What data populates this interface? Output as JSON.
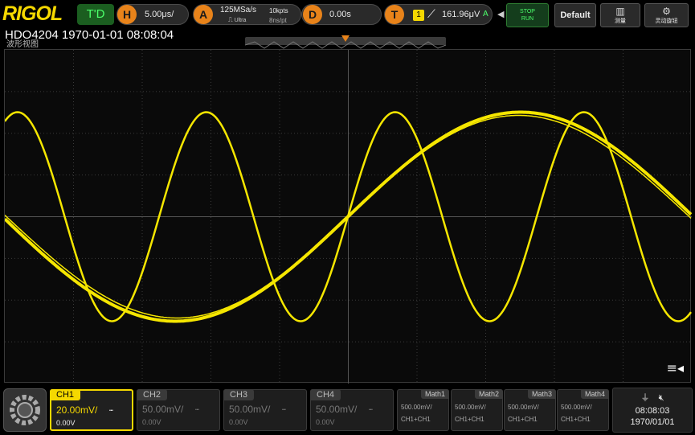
{
  "brand": "RIGOL",
  "device": "HDO4204 1970-01-01 08:08:04",
  "view_label": "波形视图",
  "trigger_status": "T'D",
  "horizontal": {
    "badge": "H",
    "timebase": "5.00μs/"
  },
  "acquisition": {
    "badge": "A",
    "sample_rate": "125MSa/s",
    "mode": "Ultra",
    "memory_depth": "10kpts",
    "resolution": "8ns/pt"
  },
  "delay": {
    "badge": "D",
    "value": "0.00s"
  },
  "trigger": {
    "badge": "T",
    "source": "1",
    "level": "161.96μV",
    "sweep": "A"
  },
  "buttons": {
    "stop": "STOP",
    "run": "RUN",
    "default": "Default",
    "measure": "测量",
    "autoset": "灵动旋钮"
  },
  "channels": [
    {
      "name": "CH1",
      "scale": "20.00mV/",
      "offset": "0.00V",
      "coupling": "DC",
      "active": true
    },
    {
      "name": "CH2",
      "scale": "50.00mV/",
      "offset": "0.00V",
      "coupling": "DC",
      "active": false
    },
    {
      "name": "CH3",
      "scale": "50.00mV/",
      "offset": "0.00V",
      "coupling": "DC",
      "active": false
    },
    {
      "name": "CH4",
      "scale": "50.00mV/",
      "offset": "0.00V",
      "coupling": "DC",
      "active": false
    }
  ],
  "math": [
    {
      "name": "Math1",
      "scale": "500.00mV/",
      "source": "CH1+CH1"
    },
    {
      "name": "Math2",
      "scale": "500.00mV/",
      "source": "CH1+CH1"
    },
    {
      "name": "Math3",
      "scale": "500.00mV/",
      "source": "CH1+CH1"
    },
    {
      "name": "Math4",
      "scale": "500.00mV/",
      "source": "CH1+CH1"
    }
  ],
  "clock": {
    "time": "08:08:03",
    "date": "1970/01/01"
  },
  "colors": {
    "trace": "#f5e600",
    "accent": "#f5d800",
    "badge": "#e8831a",
    "run_green": "#4cff6b"
  }
}
